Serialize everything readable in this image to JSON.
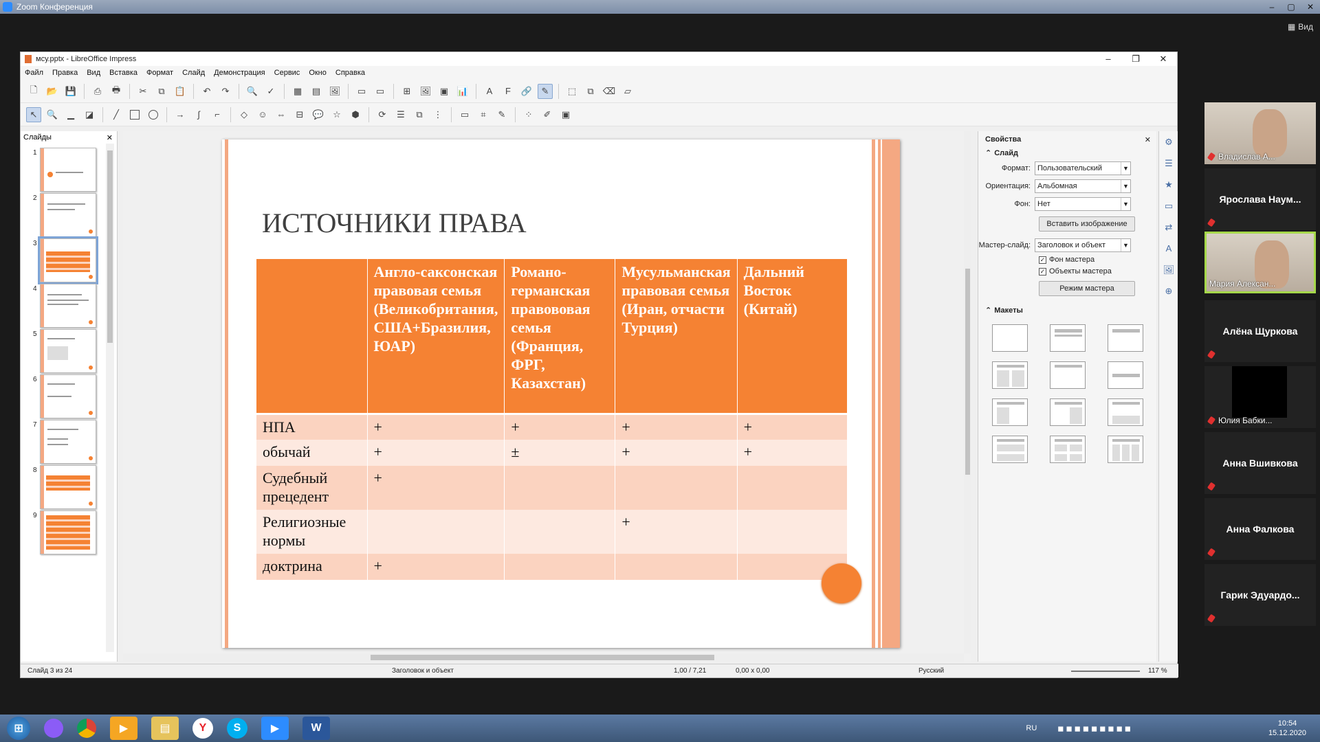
{
  "zoom": {
    "title": "Zoom Конференция",
    "view_label": "Вид"
  },
  "lo": {
    "title": "мсу.pptx - LibreOffice Impress",
    "menu": [
      "Файл",
      "Правка",
      "Вид",
      "Вставка",
      "Формат",
      "Слайд",
      "Демонстрация",
      "Сервис",
      "Окно",
      "Справка"
    ]
  },
  "slides_panel": {
    "title": "Слайды",
    "numbers": [
      "1",
      "2",
      "3",
      "4",
      "5",
      "6",
      "7",
      "8",
      "9"
    ]
  },
  "slide": {
    "title": "ИСТОЧНИКИ ПРАВА",
    "headers": [
      "",
      "Англо-саксонская правовая семья (Великобритания, США+Бразилия, ЮАР)",
      "Романо-германская правововая семья (Франция, ФРГ, Казахстан)",
      "Мусульманская правовая семья (Иран, отчасти Турция)",
      "Дальний Восток (Китай)"
    ],
    "rows": [
      [
        "НПА",
        "+",
        "+",
        "+",
        "+"
      ],
      [
        "обычай",
        "+",
        "±",
        "+",
        "+"
      ],
      [
        "Судебный прецедент",
        "+",
        "",
        "",
        ""
      ],
      [
        "Религиозные нормы",
        "",
        "",
        "+",
        ""
      ],
      [
        "доктрина",
        "+",
        "",
        "",
        ""
      ]
    ]
  },
  "props": {
    "title": "Свойства",
    "slide_section": "Слайд",
    "format_label": "Формат:",
    "format_value": "Пользовательский",
    "orientation_label": "Ориентация:",
    "orientation_value": "Альбомная",
    "bg_label": "Фон:",
    "bg_value": "Нет",
    "insert_image": "Вставить изображение",
    "master_label": "Мастер-слайд:",
    "master_value": "Заголовок и объект",
    "master_bg": "Фон мастера",
    "master_objects": "Объекты мастера",
    "master_mode": "Режим мастера",
    "layouts_section": "Макеты"
  },
  "status": {
    "slide_of": "Слайд 3 из 24",
    "layout": "Заголовок и объект",
    "position": "1,00 / 7,21",
    "size": "0,00 x 0,00",
    "language": "Русский",
    "zoom": "117 %"
  },
  "participants": [
    {
      "name": "Владислав А...",
      "video": true
    },
    {
      "name": "Ярослава  Наум...",
      "video": false
    },
    {
      "name": "Мария Алексан...",
      "video": true,
      "highlight": true
    },
    {
      "name": "Алёна Щуркова",
      "video": false
    },
    {
      "name": "Юлия Бабки...",
      "video": false,
      "black": true
    },
    {
      "name": "Анна Вшивкова",
      "video": false
    },
    {
      "name": "Анна Фалкова",
      "video": false
    },
    {
      "name": "Гарик  Эдуардо...",
      "video": false
    }
  ],
  "taskbar": {
    "lang": "RU",
    "time": "10:54",
    "date": "15.12.2020"
  }
}
